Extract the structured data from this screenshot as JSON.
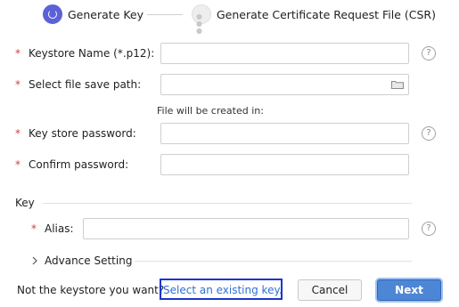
{
  "steps": [
    {
      "label": "Generate Key",
      "state": "active",
      "icon": "refresh-icon"
    },
    {
      "label": "Generate Certificate Request File (CSR)",
      "state": "inactive",
      "icon": "ellipsis-icon"
    }
  ],
  "fields": {
    "keystore_name": {
      "label": "Keystore Name (*.p12):",
      "value": "",
      "required": "*"
    },
    "save_path": {
      "label": "Select file save path:",
      "value": "",
      "required": "*",
      "hint": "File will be created in:"
    },
    "keystore_password": {
      "label": "Key store password:",
      "value": "",
      "required": "*"
    },
    "confirm_password": {
      "label": "Confirm password:",
      "value": "",
      "required": "*"
    }
  },
  "key_section": {
    "title": "Key",
    "alias": {
      "label": "Alias:",
      "value": "",
      "required": "*"
    },
    "advance_label": "Advance Setting"
  },
  "footer": {
    "prompt": "Not the keystore you want?",
    "link": "Select an existing key.",
    "cancel": "Cancel",
    "next": "Next"
  },
  "help_glyph": "?",
  "colors": {
    "accent": "#5b62d6",
    "link": "#2e6fd6",
    "required": "#d43b3b",
    "primary_button": "#4e86d6"
  }
}
